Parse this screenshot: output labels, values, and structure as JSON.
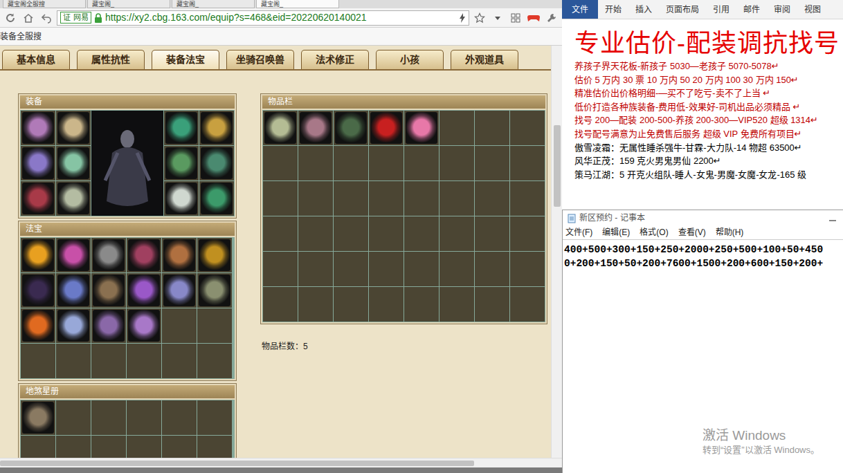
{
  "browser": {
    "tabs": [
      {
        "label": "藏宝阁全服搜",
        "selected": false
      },
      {
        "label": "藏宝阁_",
        "selected": false
      },
      {
        "label": "藏宝阁_",
        "selected": false
      },
      {
        "label": "藏宝阁_",
        "selected": true
      }
    ],
    "badge_mark": "证",
    "brand": "网易",
    "url": "https://xy2.cbg.163.com/equip?s=468&eid=20220620140021",
    "bookmark": "装备全服搜"
  },
  "page": {
    "tabs": [
      {
        "label": "基本信息",
        "selected": false
      },
      {
        "label": "属性抗性",
        "selected": false
      },
      {
        "label": "装备法宝",
        "selected": true
      },
      {
        "label": "坐骑召唤兽",
        "selected": false
      },
      {
        "label": "法术修正",
        "selected": false
      },
      {
        "label": "小孩",
        "selected": false
      },
      {
        "label": "外观道具",
        "selected": false
      }
    ],
    "equipment": {
      "title": "装备",
      "left": [
        {
          "color": "#b07ab8"
        },
        {
          "color": "#cbb68a"
        },
        {
          "color": "#8a78c8"
        },
        {
          "color": "#86c4a4"
        },
        {
          "color": "#a83a48"
        },
        {
          "color": "#b4bca2"
        }
      ],
      "right": [
        {
          "color": "#3aa07a"
        },
        {
          "color": "#c8a040"
        },
        {
          "color": "#5a9a60"
        },
        {
          "color": "#4a8a70"
        },
        {
          "color": "#d0d8d0"
        },
        {
          "color": "#3c9a6a"
        }
      ]
    },
    "treasures": {
      "title": "法宝",
      "items": [
        {
          "color": "#e8a020"
        },
        {
          "color": "#c850a8"
        },
        {
          "color": "#8a8a8a"
        },
        {
          "color": "#a04060"
        },
        {
          "color": "#b07040"
        },
        {
          "color": "#c09020"
        },
        {
          "color": "#3a2a50"
        },
        {
          "color": "#6a7ac8"
        },
        {
          "color": "#8a7050"
        },
        {
          "color": "#9a58c8"
        },
        {
          "color": "#8888c8"
        },
        {
          "color": "#8a9070"
        },
        {
          "color": "#e06a20"
        },
        {
          "color": "#98a8d8"
        },
        {
          "color": "#8a68a8"
        },
        {
          "color": "#a878c8"
        }
      ]
    },
    "star_book": {
      "title": "地煞星册",
      "items": [
        {
          "color": "#8a7a62"
        }
      ]
    },
    "inventory": {
      "title": "物品栏",
      "items": [
        {
          "color": "#b4bc94"
        },
        {
          "color": "#a87888"
        },
        {
          "color": "#4a6a48"
        },
        {
          "color": "#c82020"
        },
        {
          "color": "#e878a8"
        }
      ],
      "count_label": "物品栏数：5"
    }
  },
  "word": {
    "file_tab": "文件",
    "tabs": [
      "开始",
      "插入",
      "页面布局",
      "引用",
      "邮件",
      "审阅",
      "视图"
    ],
    "title": "专业估价-配装调抗找号",
    "lines": [
      {
        "text": "养孩子界天花板-新孩子 5030—老孩子 5070-5078↵",
        "color": "#c00000"
      },
      {
        "text": "估价 5 万内 30 票  10 万内 50  20 万内 100  30 万内 150↵",
        "color": "#c00000"
      },
      {
        "text": "精准估价出价格明细-—买不了吃亏-卖不了上当 ↵",
        "color": "#c00000"
      },
      {
        "text": "低价打造各种族装备-费用低-效果好-司机出品必须精品 ↵",
        "color": "#c00000"
      },
      {
        "text": "找号 200—配装 200-500-养孩 200-300—VIP520 超级 1314↵",
        "color": "#c00000"
      },
      {
        "text": "找号配号满意为止免费售后服务  超级 VIP 免费所有项目↵",
        "color": "#c00000"
      },
      {
        "text": "傲雪凌霜：无属性睡杀强牛-甘霖-大力队-14 物超 63500↵",
        "color": "#000000"
      },
      {
        "text": "风华正茂：159 克火男鬼男仙 2200↵",
        "color": "#000000"
      },
      {
        "text": "策马江湖：5 开克火组队-睡人-女鬼-男魔-女魔-女龙-165 级",
        "color": "#000000"
      }
    ]
  },
  "notepad": {
    "title": "新区预约 - 记事本",
    "menu": [
      "文件(F)",
      "编辑(E)",
      "格式(O)",
      "查看(V)",
      "帮助(H)"
    ],
    "lines": [
      "400+500+300+150+250+2000+250+500+100+50+450",
      "0+200+150+50+200+7600+1500+200+600+150+200+"
    ]
  },
  "watermark": {
    "title": "激活 Windows",
    "hint": "转到“设置”以激活 Windows。"
  }
}
